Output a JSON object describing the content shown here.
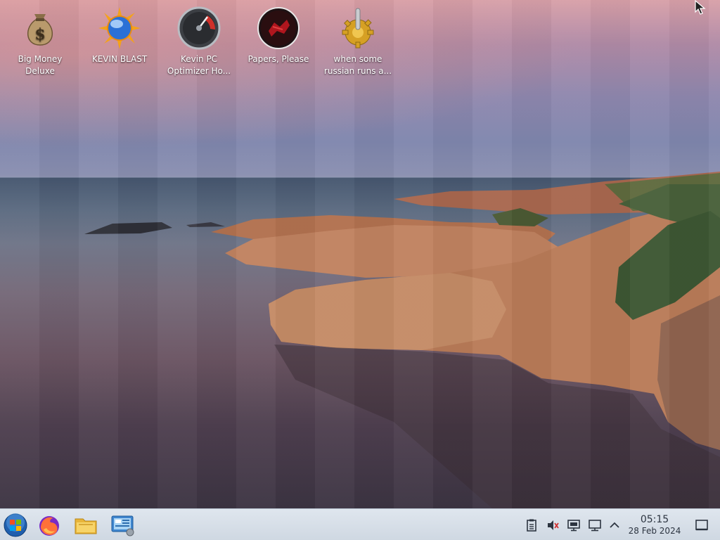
{
  "desktop": {
    "icons": [
      {
        "label": "Big Money Deluxe",
        "icon": "money-bag-icon"
      },
      {
        "label": "KEVIN BLAST",
        "icon": "sun-globe-icon"
      },
      {
        "label": "Kevin PC Optimizer Ho...",
        "icon": "speedometer-icon"
      },
      {
        "label": "Papers, Please",
        "icon": "stamp-seal-icon"
      },
      {
        "label": "when some russian runs a...",
        "icon": "gear-joystick-icon"
      }
    ]
  },
  "taskbar": {
    "pinned": [
      {
        "name": "start-menu-button",
        "icon": "windows-orb-icon"
      },
      {
        "name": "firefox-button",
        "icon": "firefox-icon"
      },
      {
        "name": "file-explorer-button",
        "icon": "folder-icon"
      },
      {
        "name": "control-panel-button",
        "icon": "control-panel-icon"
      }
    ],
    "tray": [
      {
        "name": "clipboard-icon"
      },
      {
        "name": "volume-muted-icon"
      },
      {
        "name": "display-icon"
      },
      {
        "name": "network-icon"
      },
      {
        "name": "chevron-up-icon"
      }
    ],
    "clock": {
      "time": "05:15",
      "date": "28 Feb 2024"
    }
  },
  "colors": {
    "taskbar": "#d6dee8",
    "accent": "#2f7fd0"
  }
}
